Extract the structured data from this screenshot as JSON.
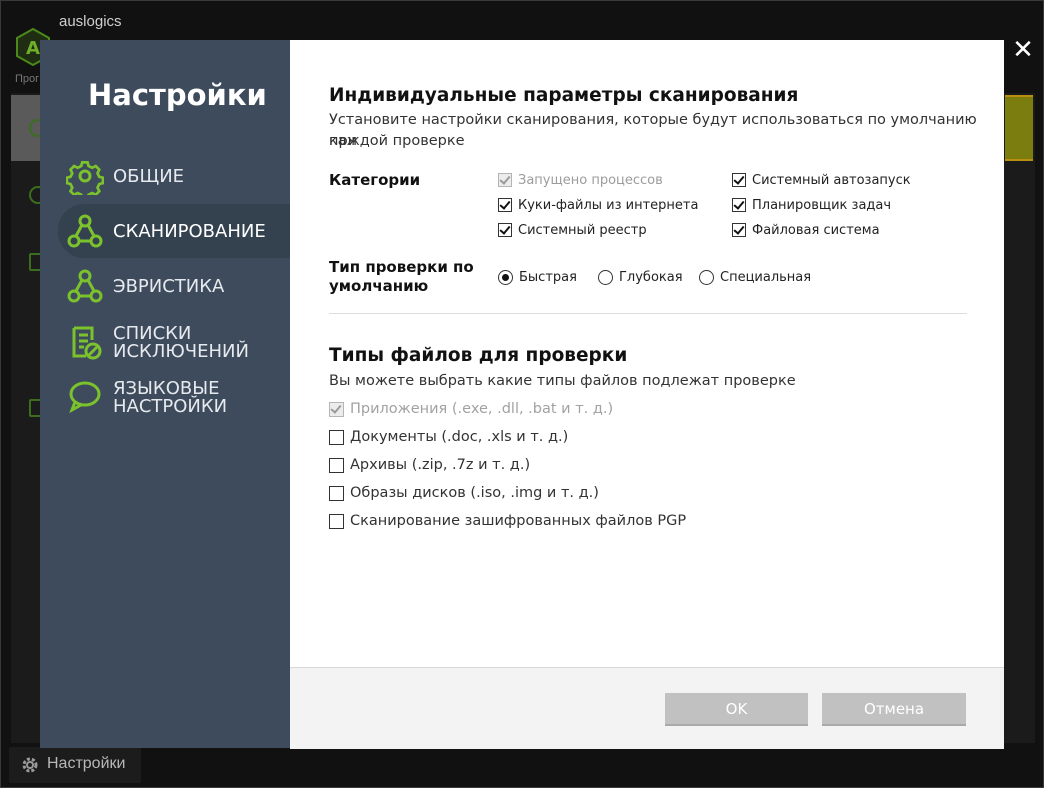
{
  "background": {
    "brand": "auslogics",
    "subtitle": "Прог",
    "bottom_button_label": "Настройки"
  },
  "sidebar": {
    "title": "Настройки",
    "items": [
      {
        "line1": "ОБЩИЕ",
        "line2": "",
        "icon": "gear-icon",
        "active": false
      },
      {
        "line1": "СКАНИРОВАНИЕ",
        "line2": "",
        "icon": "scan-nodes-icon",
        "active": true
      },
      {
        "line1": "ЭВРИСТИКА",
        "line2": "",
        "icon": "heuristics-nodes-icon",
        "active": false
      },
      {
        "line1": "СПИСКИ",
        "line2": "ИСКЛЮЧЕНИЙ",
        "icon": "exclusion-list-icon",
        "active": false
      },
      {
        "line1": "ЯЗЫКОВЫЕ",
        "line2": "НАСТРОЙКИ",
        "icon": "speech-bubble-icon",
        "active": false
      }
    ]
  },
  "scan_params": {
    "heading": "Индивидуальные параметры сканирования",
    "description_line1": "Установите настройки сканирования, которые будут использоваться по умолчанию при",
    "description_line2": "каждой проверке",
    "categories_label": "Категории",
    "categories": [
      {
        "label": "Запущено процессов",
        "checked": true,
        "disabled": true
      },
      {
        "label": "Системный автозапуск",
        "checked": true,
        "disabled": false
      },
      {
        "label": "Куки-файлы из интернета",
        "checked": true,
        "disabled": false
      },
      {
        "label": "Планировщик задач",
        "checked": true,
        "disabled": false
      },
      {
        "label": "Системный реестр",
        "checked": true,
        "disabled": false
      },
      {
        "label": "Файловая система",
        "checked": true,
        "disabled": false
      }
    ],
    "scan_type_label_line1": "Тип проверки по",
    "scan_type_label_line2": "умолчанию",
    "scan_types": [
      {
        "label": "Быстрая",
        "selected": true
      },
      {
        "label": "Глубокая",
        "selected": false
      },
      {
        "label": "Специальная",
        "selected": false
      }
    ]
  },
  "file_types": {
    "heading": "Типы файлов для проверки",
    "description": "Вы можете выбрать какие типы файлов подлежат проверке",
    "items": [
      {
        "label": "Приложения (.exe, .dll, .bat и т. д.)",
        "checked": true,
        "disabled": true
      },
      {
        "label": "Документы (.doc, .xls и т. д.)",
        "checked": false,
        "disabled": false
      },
      {
        "label": "Архивы (.zip, .7z и т. д.)",
        "checked": false,
        "disabled": false
      },
      {
        "label": "Образы дисков (.iso, .img и т. д.)",
        "checked": false,
        "disabled": false
      },
      {
        "label": "Сканирование зашифрованных файлов PGP",
        "checked": false,
        "disabled": false
      }
    ]
  },
  "footer": {
    "ok_label": "OK",
    "cancel_label": "Отмена"
  },
  "colors": {
    "sidebar_bg": "#3d4b5c",
    "sidebar_active_bg": "#34414f",
    "icon_green": "#7cc22c",
    "button_bg": "#c1c1c1"
  }
}
